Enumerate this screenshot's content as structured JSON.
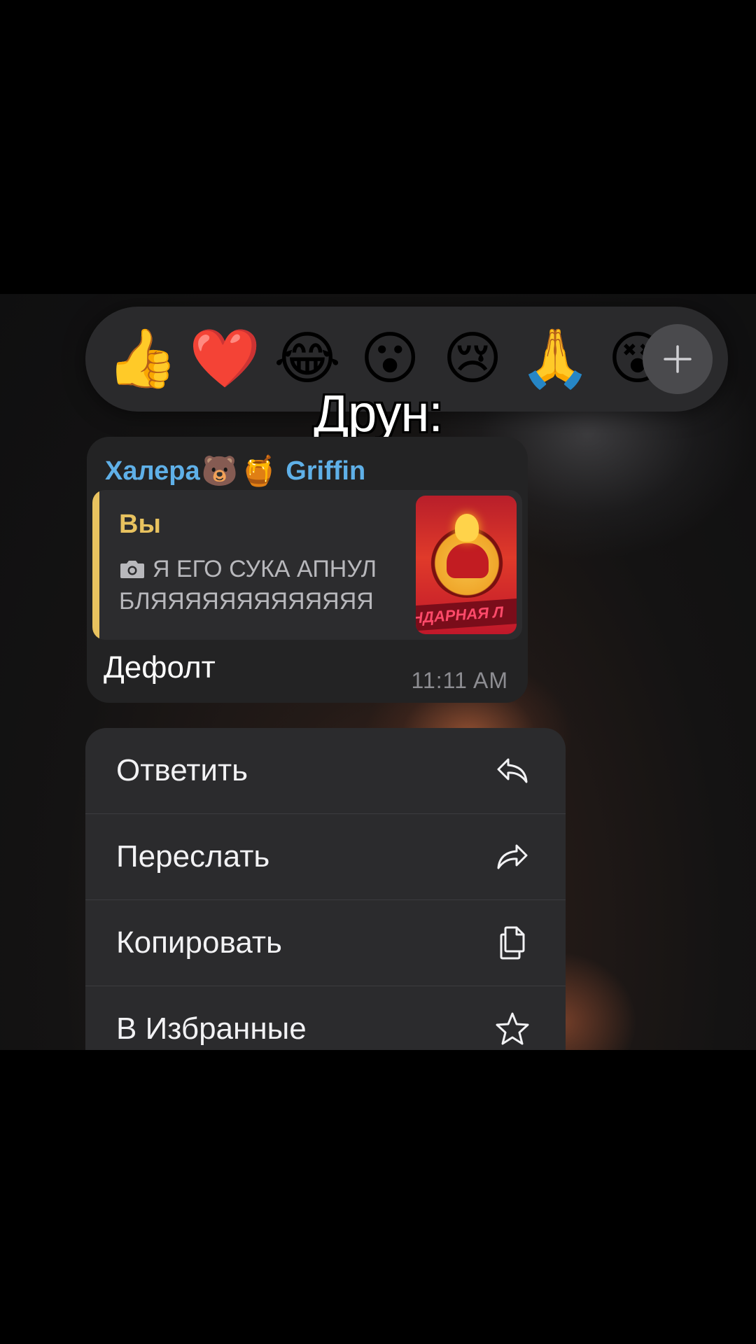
{
  "reactions": {
    "items": [
      "👍",
      "❤️",
      "😂",
      "😮",
      "😢",
      "🙏",
      "😵"
    ],
    "more_icon": "plus-icon"
  },
  "caption": "Друн:",
  "message": {
    "sender_name": "Халера",
    "sender_emoji_1": "🐻",
    "sender_emoji_2": "🍯",
    "sender_name_2": "Griffin",
    "reply": {
      "author": "Вы",
      "text": "Я ЕГО СУКА АПНУЛ\nБЛЯЯЯЯЯЯЯЯЯЯЯЯЯ",
      "thumbnail_text": "НДАРНАЯ Л"
    },
    "text": "Дефолт",
    "time": "11:11 AM"
  },
  "menu": {
    "items": [
      {
        "label": "Ответить",
        "icon": "reply-icon"
      },
      {
        "label": "Переслать",
        "icon": "forward-icon"
      },
      {
        "label": "Копировать",
        "icon": "copy-icon"
      },
      {
        "label": "В Избранные",
        "icon": "star-icon"
      }
    ]
  },
  "colors": {
    "sender": "#5fb0e8",
    "reply_accent": "#e8c25f",
    "bubble_bg": "#232324",
    "menu_bg": "#2b2b2d"
  }
}
